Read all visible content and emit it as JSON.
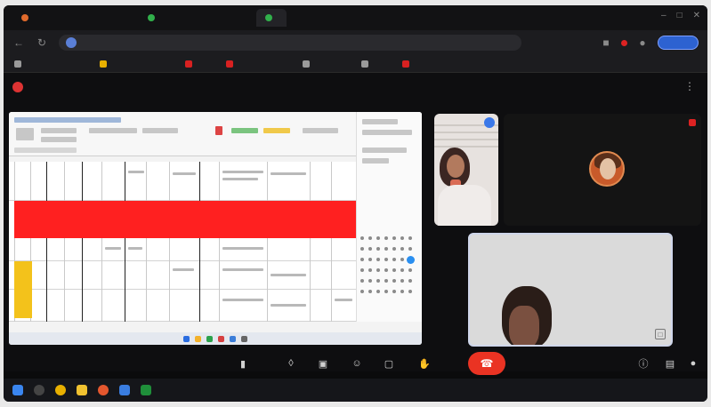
{
  "browser": {
    "tabs": [
      {
        "label": "",
        "color": "#e06a2c"
      },
      {
        "label": "",
        "color": "#31b04b"
      },
      {
        "label": "",
        "color": "#31b04b"
      }
    ],
    "url": "",
    "profile_label": ""
  },
  "bookmarks": [
    {
      "label": "",
      "color": "#9a9a9a"
    },
    {
      "label": "",
      "color": "#e8b000"
    },
    {
      "label": "",
      "color": "#d82121"
    },
    {
      "label": "",
      "color": "#d82121"
    },
    {
      "label": "",
      "color": "#9a9a9a"
    },
    {
      "label": "",
      "color": "#9a9a9a"
    },
    {
      "label": "",
      "color": "#d82121"
    }
  ],
  "meeting": {
    "title": "",
    "time_label": "",
    "participants": [
      {
        "name": ""
      },
      {
        "name": ""
      }
    ],
    "colors": {
      "end_call": "#ea3323",
      "highlight_row": "#ff2020",
      "highlight_cell": "#f3c21b"
    }
  },
  "taskbar": {
    "icons": [
      "windows-start-icon",
      "search-icon",
      "chrome-icon",
      "file-explorer-icon",
      "firefox-icon",
      "store-icon",
      "excel-icon"
    ],
    "tray_text": ""
  }
}
